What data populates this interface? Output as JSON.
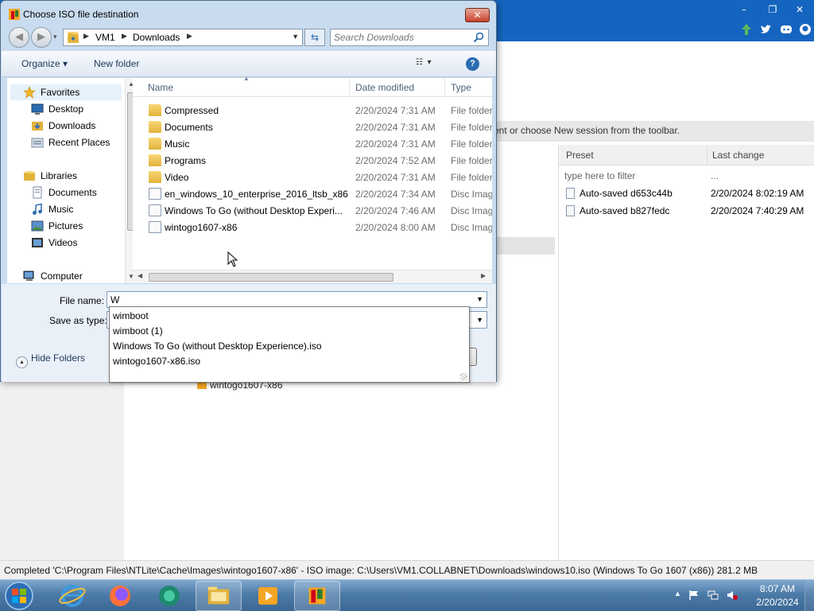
{
  "dialog": {
    "title": "Choose ISO file destination",
    "close_label": "✕",
    "address": {
      "seg1": "VM1",
      "seg2": "Downloads"
    },
    "search_placeholder": "Search Downloads",
    "toolbar": {
      "organize": "Organize ▾",
      "new_folder": "New folder",
      "help": "?"
    },
    "nav": {
      "favorites": "Favorites",
      "desktop": "Desktop",
      "downloads": "Downloads",
      "recent": "Recent Places",
      "libraries": "Libraries",
      "documents": "Documents",
      "music": "Music",
      "pictures": "Pictures",
      "videos": "Videos",
      "computer": "Computer"
    },
    "columns": {
      "name": "Name",
      "date": "Date modified",
      "type": "Type"
    },
    "files": [
      {
        "name": "Compressed",
        "date": "2/20/2024 7:31 AM",
        "type": "File folder",
        "icon": "folder-icon"
      },
      {
        "name": "Documents",
        "date": "2/20/2024 7:31 AM",
        "type": "File folder",
        "icon": "folder-icon"
      },
      {
        "name": "Music",
        "date": "2/20/2024 7:31 AM",
        "type": "File folder",
        "icon": "folder-icon"
      },
      {
        "name": "Programs",
        "date": "2/20/2024 7:52 AM",
        "type": "File folder",
        "icon": "folder-icon"
      },
      {
        "name": "Video",
        "date": "2/20/2024 7:31 AM",
        "type": "File folder",
        "icon": "folder-icon"
      },
      {
        "name": "en_windows_10_enterprise_2016_ltsb_x86...",
        "date": "2/20/2024 7:34 AM",
        "type": "Disc Imag",
        "icon": "disc-image-icon"
      },
      {
        "name": "Windows To Go (without Desktop Experi...",
        "date": "2/20/2024 7:46 AM",
        "type": "Disc Imag",
        "icon": "disc-image-icon"
      },
      {
        "name": "wintogo1607-x86",
        "date": "2/20/2024 8:00 AM",
        "type": "Disc Imag",
        "icon": "disc-image-icon"
      }
    ],
    "file_name_label": "File name:",
    "file_name_value": "W",
    "save_as_type_label": "Save as type:",
    "hide_folders": "Hide Folders",
    "autocomplete": [
      "wimboot",
      "wimboot (1)",
      "Windows To Go (without Desktop Experience).iso",
      "wintogo1607-x86.iso"
    ]
  },
  "app": {
    "hint": "ent or choose New session from the toolbar.",
    "tree_item": "wintogo1607-x86",
    "window_buttons": {
      "minimize": "–",
      "restore": "❐",
      "close": "✕"
    },
    "presets": {
      "col_preset": "Preset",
      "col_last_change": "Last change",
      "filter_placeholder": "type here to filter",
      "filter_ellipsis": "...",
      "rows": [
        {
          "name": "Auto-saved d653c44b",
          "date": "2/20/2024 8:02:19 AM"
        },
        {
          "name": "Auto-saved b827fedc",
          "date": "2/20/2024 7:40:29 AM"
        }
      ]
    },
    "status": "Completed  'C:\\Program Files\\NTLite\\Cache\\Images\\wintogo1607-x86' - ISO image: C:\\Users\\VM1.COLLABNET\\Downloads\\windows10.iso (Windows To Go 1607 (x86)) 281.2 MB"
  },
  "taskbar": {
    "time": "8:07 AM",
    "date": "2/20/2024"
  },
  "colors": {
    "app_accent": "#1565c0",
    "taskbar": "#4d7ba8",
    "dialog_frame": "#c9dcef"
  }
}
